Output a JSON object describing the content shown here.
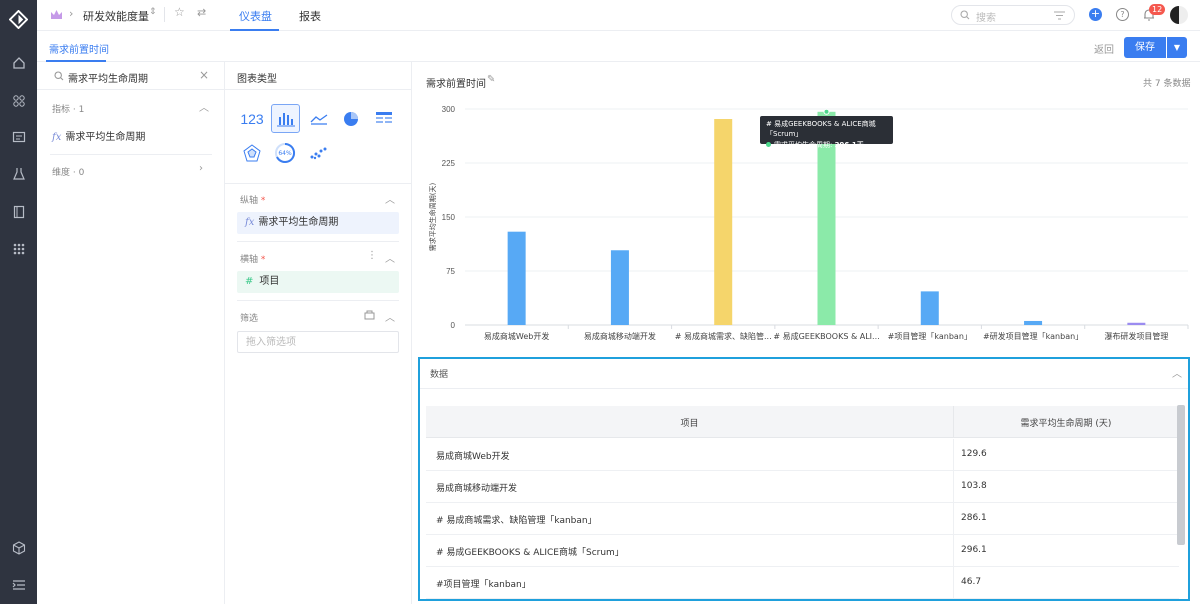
{
  "header": {
    "breadcrumb_title": "研发效能度量",
    "tabs": [
      {
        "label": "仪表盘"
      },
      {
        "label": "报表"
      }
    ],
    "search_placeholder": "搜索",
    "notification_count": "12"
  },
  "subbar": {
    "tab_label": "需求前置时间",
    "back_label": "返回",
    "save_label": "保存"
  },
  "metrics_panel": {
    "search_value": "需求平均生命周期",
    "metrics_header": "指标 · 1",
    "metric_item": "需求平均生命周期",
    "dimension_header": "维度 · 0"
  },
  "chart_type_panel": {
    "title": "图表类型",
    "kpi_label": "123",
    "gauge_label": "64%",
    "y_axis_header": "纵轴",
    "y_axis_field": "需求平均生命周期",
    "x_axis_header": "横轴",
    "x_axis_field": "项目",
    "filter_header": "筛选",
    "filter_placeholder": "拖入筛选项"
  },
  "chart_panel": {
    "title": "需求前置时间",
    "count_text": "共 7 条数据",
    "tooltip_title": "# 易成GEEKBOOKS & ALICE商城「Scrum」",
    "tooltip_metric": "需求平均生命周期:",
    "tooltip_value": "296.1天"
  },
  "chart_data": {
    "type": "bar",
    "ylabel": "需求平均生命周期(天)",
    "ylim": [
      0,
      300
    ],
    "yticks": [
      "0",
      "75",
      "150",
      "225",
      "300"
    ],
    "categories": [
      "易成商城Web开发",
      "易成商城移动端开发",
      "# 易成商城需求、缺陷管...",
      "# 易成GEEKBOOKS & ALI...",
      "#项目管理「kanban」",
      "#研发项目管理「kanban」",
      "瀑布研发项目管理"
    ],
    "values": [
      129.6,
      103.8,
      286.1,
      296.1,
      46.7,
      5.6,
      3.1
    ],
    "colors": [
      "#57a9f5",
      "#57a9f5",
      "#f5d56b",
      "#8beaa9",
      "#57a9f5",
      "#57a9f5",
      "#9b8cf0"
    ]
  },
  "data_table": {
    "title": "数据",
    "columns": [
      "项目",
      "需求平均生命周期 (天)"
    ],
    "rows": [
      [
        "易成商城Web开发",
        "129.6"
      ],
      [
        "易成商城移动端开发",
        "103.8"
      ],
      [
        "# 易成商城需求、缺陷管理「kanban」",
        "286.1"
      ],
      [
        "# 易成GEEKBOOKS & ALICE商城「Scrum」",
        "296.1"
      ],
      [
        "#项目管理「kanban」",
        "46.7"
      ]
    ]
  }
}
